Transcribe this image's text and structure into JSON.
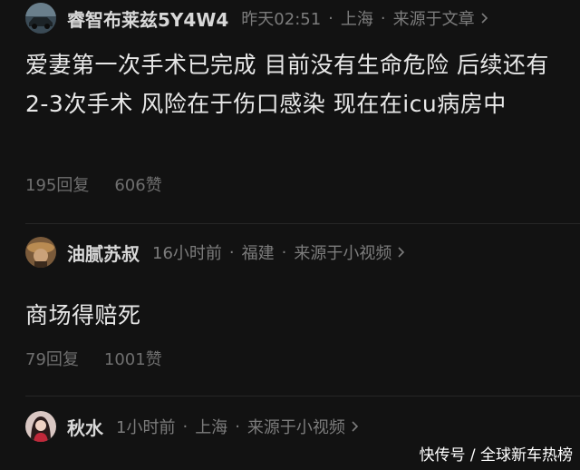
{
  "comments": [
    {
      "username": "睿智布莱兹5Y4W4",
      "time": "昨天02:51",
      "location": "上海",
      "source": "来源于文章",
      "text": "爱妻第一次手术已完成 目前没有生命危险 后续还有2-3次手术 风险在于伤口感染 现在在icu病房中",
      "replies": "195回复",
      "likes": "606赞"
    },
    {
      "username": "油腻苏叔",
      "time": "16小时前",
      "location": "福建",
      "source": "来源于小视频",
      "text": "商场得赔死",
      "replies": "79回复",
      "likes": "1001赞"
    },
    {
      "username": "秋水",
      "time": "1小时前",
      "location": "上海",
      "source": "来源于小视频"
    }
  ],
  "separator": "·",
  "watermark": "快传号 / 全球新车热榜",
  "icons": {
    "chevron": "chevron-right-icon"
  }
}
